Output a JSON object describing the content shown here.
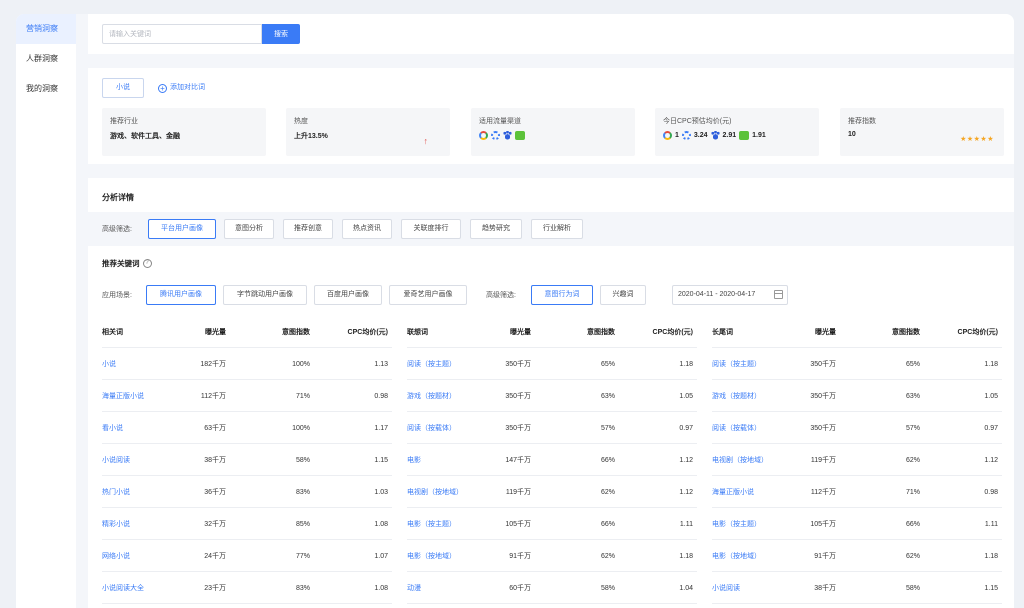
{
  "sidebar": {
    "items": [
      {
        "label": "营销洞察"
      },
      {
        "label": "人群洞察"
      },
      {
        "label": "我的洞察"
      }
    ]
  },
  "search": {
    "placeholder": "请输入关键词",
    "button": "搜索"
  },
  "overview": {
    "keyword": "小说",
    "add_compare": "添加对比词",
    "cards": {
      "industry": {
        "label": "推荐行业",
        "value": "游戏、软件工具、金融"
      },
      "heat": {
        "label": "热度",
        "value": "上升13.5%",
        "arrow": "↑"
      },
      "channels": {
        "label": "适用流量渠道",
        "icons": [
          "channel-ring-icon",
          "channel-gear-icon",
          "channel-paw-icon",
          "channel-green-icon"
        ]
      },
      "cpc": {
        "label": "今日CPC预估均价(元)",
        "values": [
          "1",
          "3.24",
          "2.91",
          "1.91"
        ]
      },
      "index": {
        "label": "推荐指数",
        "value": "10",
        "stars": "★★★★★"
      }
    }
  },
  "detail": {
    "title": "分析详情",
    "filter_label": "高级筛选:",
    "tabs": [
      "平台用户画像",
      "意图分析",
      "推荐创意",
      "热点资讯",
      "关联度排行",
      "趋势研究",
      "行业解析"
    ],
    "keywords_title": "推荐关键词",
    "scene_label": "应用场景:",
    "scenes": [
      "腾讯用户画像",
      "字节跳动用户画像",
      "百度用户画像",
      "爱奇艺用户画像"
    ],
    "advanced_label": "高级筛选:",
    "advanced": [
      "意图行为词",
      "兴趣词"
    ],
    "date_range": "2020-04-11 - 2020-04-17"
  },
  "tables": [
    {
      "headers": [
        "相关词",
        "曝光量",
        "意图指数",
        "CPC均价(元)"
      ],
      "rows": [
        [
          "小说",
          "182千万",
          "100%",
          "1.13"
        ],
        [
          "海量正版小说",
          "112千万",
          "71%",
          "0.98"
        ],
        [
          "看小说",
          "63千万",
          "100%",
          "1.17"
        ],
        [
          "小说阅读",
          "38千万",
          "58%",
          "1.15"
        ],
        [
          "热门小说",
          "36千万",
          "83%",
          "1.03"
        ],
        [
          "精彩小说",
          "32千万",
          "85%",
          "1.08"
        ],
        [
          "网络小说",
          "24千万",
          "77%",
          "1.07"
        ],
        [
          "小说阅读大全",
          "23千万",
          "83%",
          "1.08"
        ]
      ]
    },
    {
      "headers": [
        "联想词",
        "曝光量",
        "意图指数",
        "CPC均价(元)"
      ],
      "rows": [
        [
          "阅读（按主题）",
          "350千万",
          "65%",
          "1.18"
        ],
        [
          "游戏（按题材）",
          "350千万",
          "63%",
          "1.05"
        ],
        [
          "阅读（按载体）",
          "350千万",
          "57%",
          "0.97"
        ],
        [
          "电影",
          "147千万",
          "66%",
          "1.12"
        ],
        [
          "电视剧（按地域）",
          "119千万",
          "62%",
          "1.12"
        ],
        [
          "电影（按主题）",
          "105千万",
          "66%",
          "1.11"
        ],
        [
          "电影（按地域）",
          "91千万",
          "62%",
          "1.18"
        ],
        [
          "动漫",
          "60千万",
          "58%",
          "1.04"
        ]
      ]
    },
    {
      "headers": [
        "长尾词",
        "曝光量",
        "意图指数",
        "CPC均价(元)"
      ],
      "rows": [
        [
          "阅读（按主题）",
          "350千万",
          "65%",
          "1.18"
        ],
        [
          "游戏（按题材）",
          "350千万",
          "63%",
          "1.05"
        ],
        [
          "阅读（按载体）",
          "350千万",
          "57%",
          "0.97"
        ],
        [
          "电视剧（按地域）",
          "119千万",
          "62%",
          "1.12"
        ],
        [
          "海量正版小说",
          "112千万",
          "71%",
          "0.98"
        ],
        [
          "电影（按主题）",
          "105千万",
          "66%",
          "1.11"
        ],
        [
          "电影（按地域）",
          "91千万",
          "62%",
          "1.18"
        ],
        [
          "小说阅读",
          "38千万",
          "58%",
          "1.15"
        ]
      ]
    }
  ]
}
